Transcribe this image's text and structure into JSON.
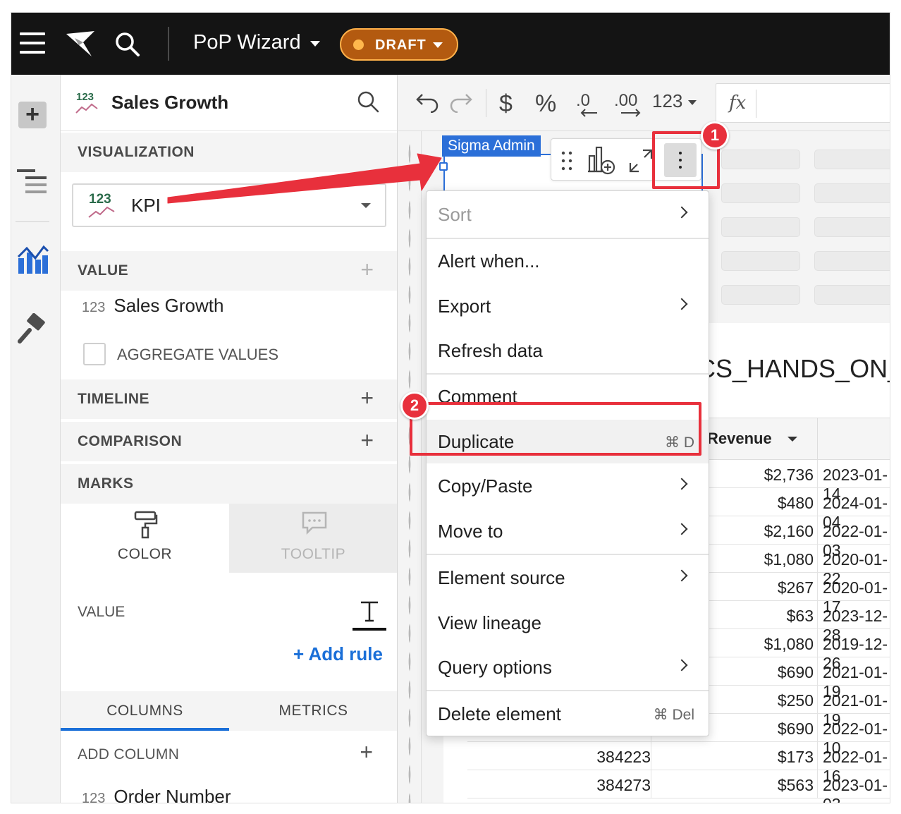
{
  "topbar": {
    "workbook_title": "PoP Wizard",
    "status_badge": "DRAFT"
  },
  "panel": {
    "element_title": "Sales Growth",
    "sections": {
      "visualization": "VISUALIZATION",
      "value": "VALUE",
      "timeline": "TIMELINE",
      "comparison": "COMPARISON",
      "marks": "MARKS"
    },
    "viz_type_icon_text": "123",
    "viz_type": "KPI",
    "value_field": {
      "type": "123",
      "name": "Sales Growth"
    },
    "aggregate_label": "AGGREGATE VALUES",
    "marks_tabs": {
      "color": "COLOR",
      "tooltip": "TOOLTIP"
    },
    "marks_value_label": "VALUE",
    "add_rule": "Add rule",
    "bottom_tabs": {
      "columns": "COLUMNS",
      "metrics": "METRICS"
    },
    "add_column": "ADD COLUMN",
    "column_item": {
      "type": "123",
      "name": "Order Number"
    }
  },
  "toolbar": {
    "number_format": "123",
    "fx": "fx"
  },
  "canvas": {
    "selected_element_tag": "Sigma Admin",
    "table_title": "CS_HANDS_ON_",
    "table_header_revenue": "Revenue",
    "table_rows": [
      {
        "order": "",
        "revenue": "$2,736",
        "date": "2023-01-14"
      },
      {
        "order": "",
        "revenue": "$480",
        "date": "2024-01-04"
      },
      {
        "order": "",
        "revenue": "$2,160",
        "date": "2022-01-03"
      },
      {
        "order": "",
        "revenue": "$1,080",
        "date": "2020-01-22"
      },
      {
        "order": "",
        "revenue": "$267",
        "date": "2020-01-17"
      },
      {
        "order": "",
        "revenue": "$63",
        "date": "2023-12-28"
      },
      {
        "order": "",
        "revenue": "$1,080",
        "date": "2019-12-26"
      },
      {
        "order": "",
        "revenue": "$690",
        "date": "2021-01-19"
      },
      {
        "order": "",
        "revenue": "$250",
        "date": "2021-01-19"
      },
      {
        "order": "",
        "revenue": "$690",
        "date": "2022-01-10"
      },
      {
        "order": "384223",
        "revenue": "$173",
        "date": "2022-01-16"
      },
      {
        "order": "384273",
        "revenue": "$563",
        "date": "2023-01-03"
      }
    ]
  },
  "context_menu": {
    "items": [
      {
        "label": "Sort",
        "submenu": true,
        "disabled": true
      },
      {
        "label": "Alert when...",
        "submenu": false
      },
      {
        "label": "Export",
        "submenu": true
      },
      {
        "label": "Refresh data",
        "submenu": false
      },
      {
        "label": "Comment",
        "submenu": false
      },
      {
        "label": "Duplicate",
        "shortcut": "⌘ D"
      },
      {
        "label": "Copy/Paste",
        "submenu": true
      },
      {
        "label": "Move to",
        "submenu": true
      },
      {
        "label": "Element source",
        "submenu": true
      },
      {
        "label": "View lineage",
        "submenu": false
      },
      {
        "label": "Query options",
        "submenu": true
      },
      {
        "label": "Delete element",
        "shortcut": "⌘ Del"
      }
    ]
  },
  "annotations": {
    "badge_1": "1",
    "badge_2": "2",
    "color": "#e8303c"
  },
  "colors": {
    "accent": "#1a6fd8",
    "selection": "#2b6fd8",
    "draft_bg": "#b35a10",
    "topbar_bg": "#141414"
  }
}
